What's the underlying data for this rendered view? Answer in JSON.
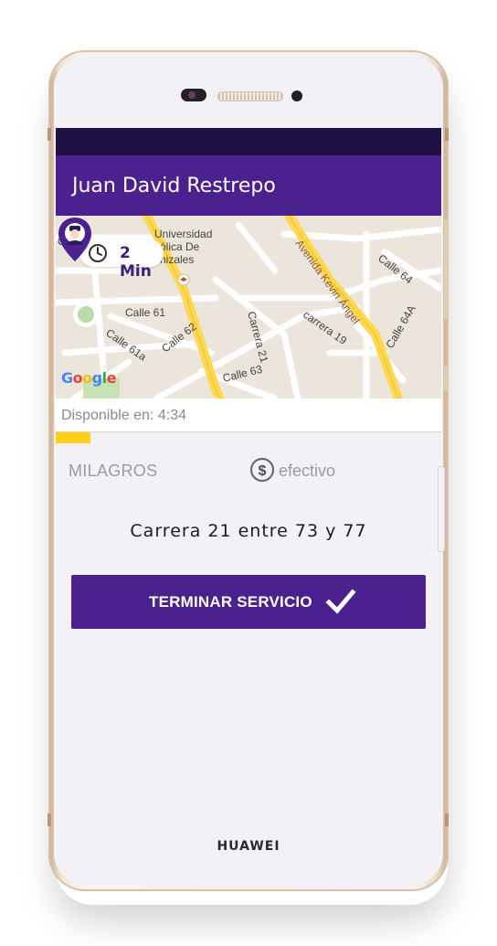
{
  "device": {
    "brand": "HUAWEI"
  },
  "app_bar": {
    "title": "Juan David Restrepo"
  },
  "map": {
    "eta_value": "2 Min",
    "provider_logo": "Google",
    "labels": {
      "carrera": "Carre",
      "universidad_line1": "Universidad",
      "universidad_line2": "ólica De",
      "universidad_line3": "nizales",
      "avenida": "Avenida Kevin Ángel",
      "calle64": "Calle 64",
      "calle64a": "Calle 64A",
      "calle61": "Calle 61",
      "calle61a": "Calle 61a",
      "calle62": "Calle 62",
      "carrera21": "Carrera 21",
      "carrera19": "carrera 19",
      "calle63": "Calle 63"
    },
    "icons": [
      "clock-icon",
      "driver-pin-icon",
      "university-marker-icon"
    ]
  },
  "availability": {
    "text": "Disponible en: 4:34",
    "progress_fraction": 0.09
  },
  "trip": {
    "zone": "MILAGROS",
    "payment_method": "efectivo",
    "payment_icon": "dollar-circle-icon",
    "address": "Carrera 21 entre 73 y 77"
  },
  "actions": {
    "finish_label": "TERMINAR SERVICIO",
    "finish_icon": "check-icon"
  },
  "colors": {
    "primary": "#4b2190",
    "status_bar": "#1f1148",
    "progress": "#ffd117"
  }
}
